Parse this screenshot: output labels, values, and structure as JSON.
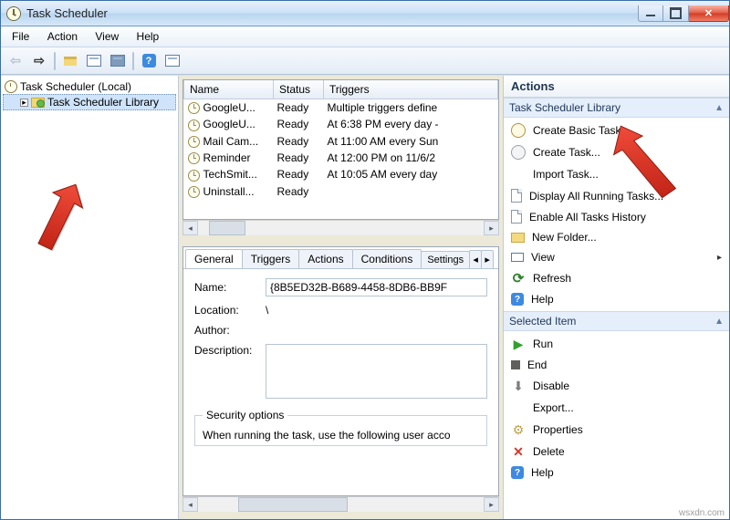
{
  "window": {
    "title": "Task Scheduler"
  },
  "menu": [
    "File",
    "Action",
    "View",
    "Help"
  ],
  "tree": {
    "root": "Task Scheduler (Local)",
    "child": "Task Scheduler Library"
  },
  "grid": {
    "headers": [
      "Name",
      "Status",
      "Triggers"
    ],
    "rows": [
      {
        "name": "GoogleU...",
        "status": "Ready",
        "triggers": "Multiple triggers define"
      },
      {
        "name": "GoogleU...",
        "status": "Ready",
        "triggers": "At 6:38 PM every day -"
      },
      {
        "name": "Mail Cam...",
        "status": "Ready",
        "triggers": "At 11:00 AM every Sun"
      },
      {
        "name": "Reminder",
        "status": "Ready",
        "triggers": "At 12:00 PM on 11/6/2"
      },
      {
        "name": "TechSmit...",
        "status": "Ready",
        "triggers": "At 10:05 AM every day"
      },
      {
        "name": "Uninstall...",
        "status": "Ready",
        "triggers": ""
      }
    ]
  },
  "tabs": [
    "General",
    "Triggers",
    "Actions",
    "Conditions",
    "Settings"
  ],
  "general": {
    "name_label": "Name:",
    "name_value": "{8B5ED32B-B689-4458-8DB6-BB9F",
    "location_label": "Location:",
    "location_value": "\\",
    "author_label": "Author:",
    "author_value": "",
    "description_label": "Description:",
    "description_value": "",
    "security_legend": "Security options",
    "security_text": "When running the task, use the following user acco"
  },
  "actions": {
    "panel_header": "Actions",
    "section1": "Task Scheduler Library",
    "items1": [
      "Create Basic Task...",
      "Create Task...",
      "Import Task...",
      "Display All Running Tasks...",
      "Enable All Tasks History",
      "New Folder...",
      "View",
      "Refresh",
      "Help"
    ],
    "section2": "Selected Item",
    "items2": [
      "Run",
      "End",
      "Disable",
      "Export...",
      "Properties",
      "Delete",
      "Help"
    ]
  },
  "watermark": "wsxdn.com"
}
